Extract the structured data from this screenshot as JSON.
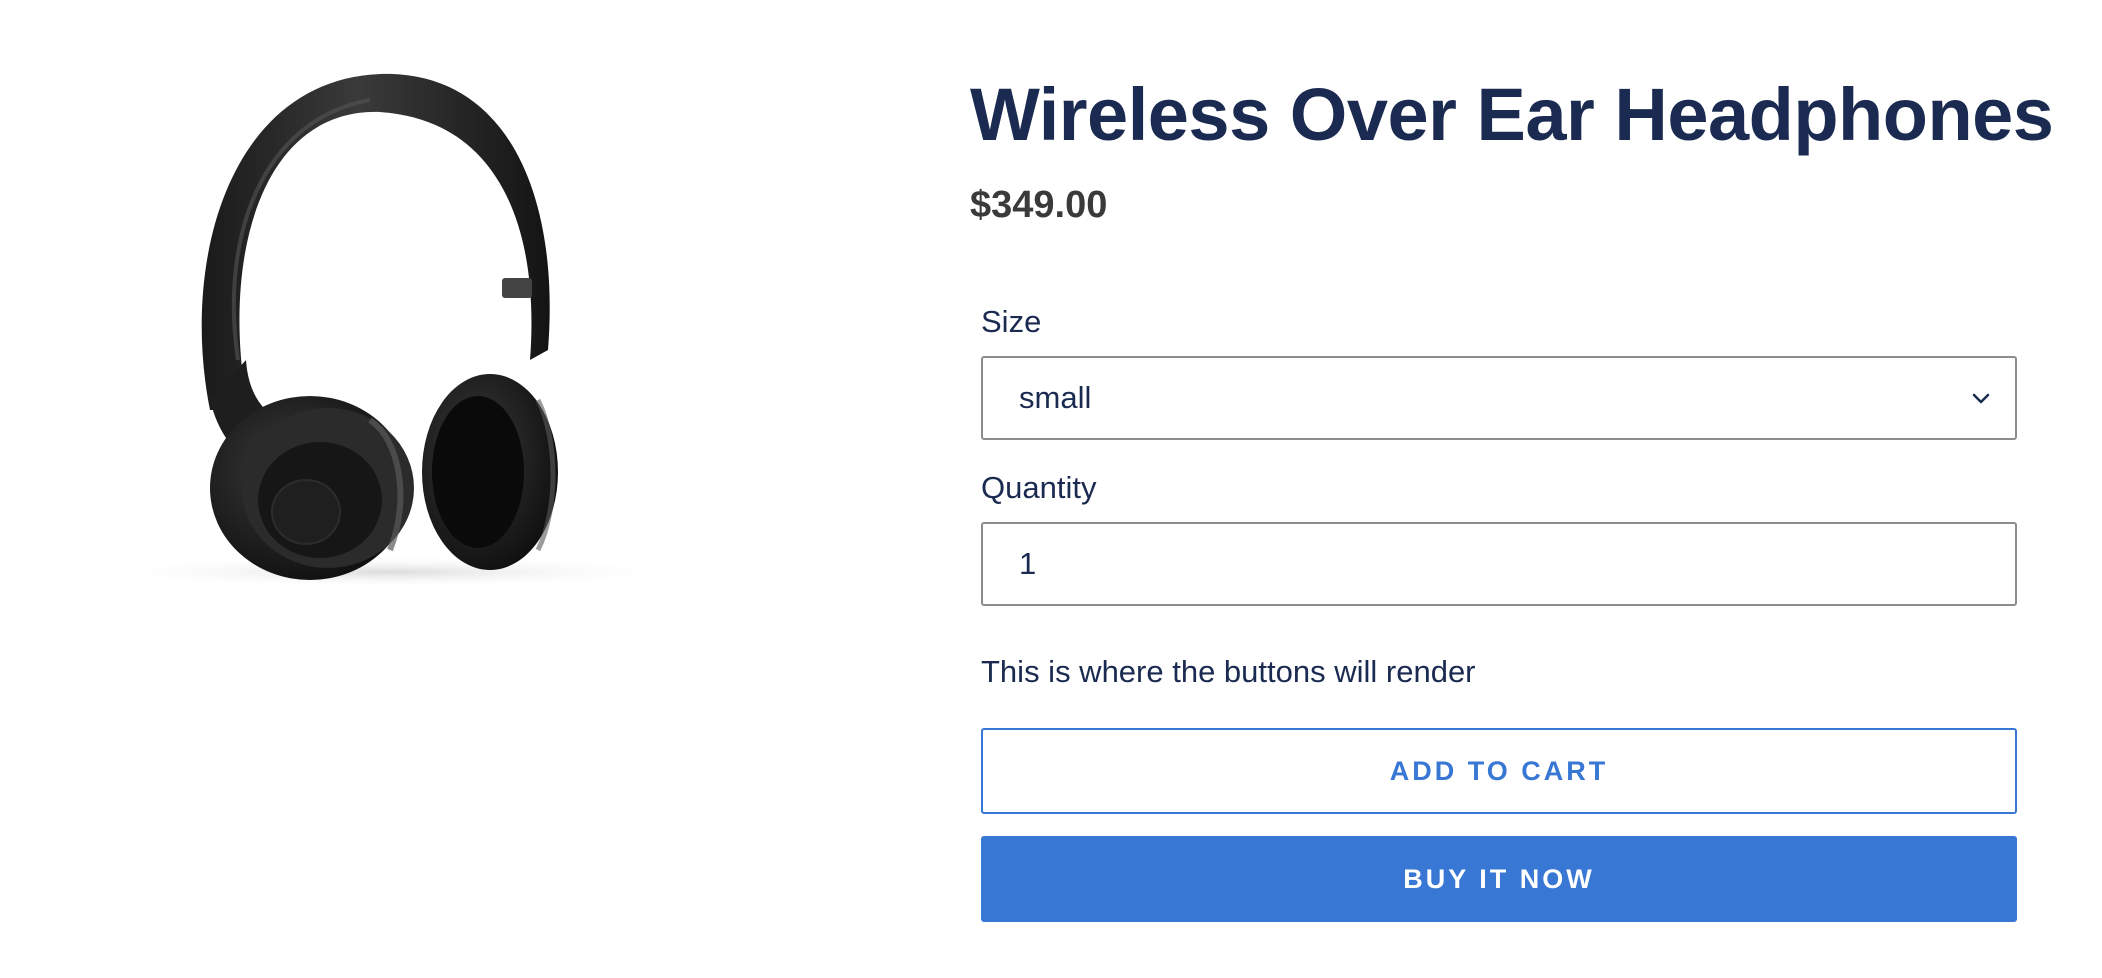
{
  "product": {
    "title": "Wireless Over Ear Headphones",
    "price": "$349.00",
    "image_alt": "headphones-image"
  },
  "options": {
    "size_label": "Size",
    "size_value": "small",
    "quantity_label": "Quantity",
    "quantity_value": "1"
  },
  "note": "This is where the buttons will render",
  "buttons": {
    "add_to_cart": "ADD TO CART",
    "buy_now": "BUY IT NOW"
  },
  "colors": {
    "accent": "#3877d4",
    "heading": "#1b2a50",
    "price": "#3a3a3a"
  }
}
